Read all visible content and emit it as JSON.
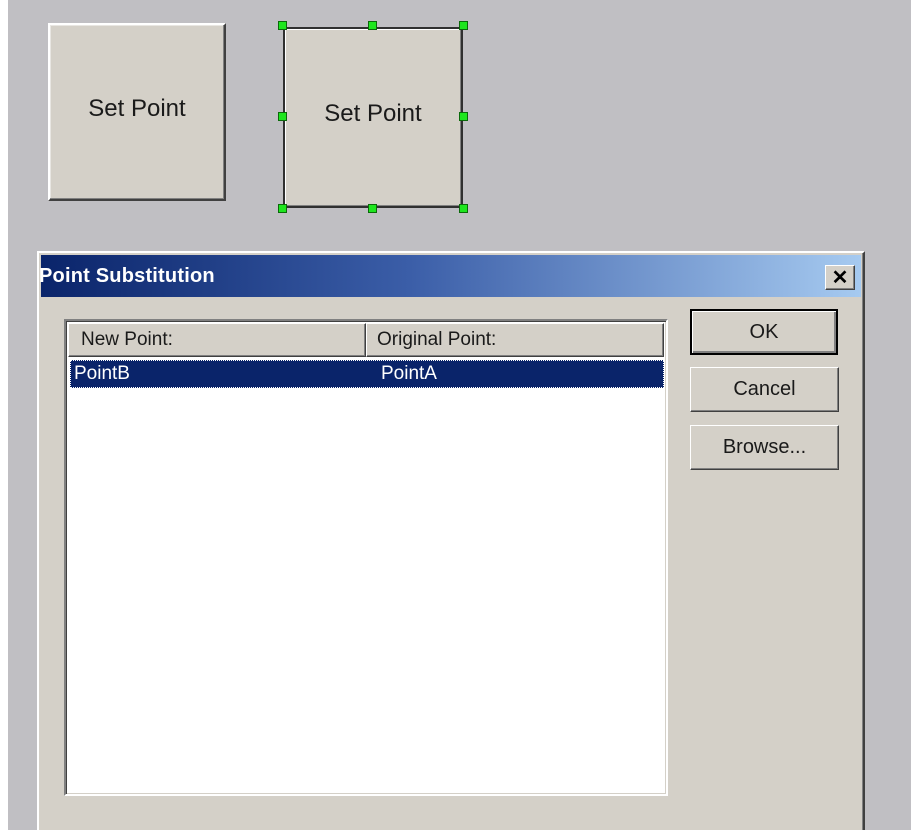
{
  "canvas": {
    "buttons": [
      {
        "label": "Set Point",
        "selected": false
      },
      {
        "label": "Set Point",
        "selected": true
      }
    ]
  },
  "dialog": {
    "title": "Point Substitution",
    "close_glyph": "✕",
    "columns": [
      "New Point:",
      "Original Point:"
    ],
    "rows": [
      {
        "new_point": "PointB",
        "original_point": "PointA",
        "selected": true
      }
    ],
    "buttons": {
      "ok": "OK",
      "cancel": "Cancel",
      "browse": "Browse..."
    }
  },
  "colors": {
    "selection_handle": "#1ee61e",
    "title_gradient_start": "#0a246a",
    "title_gradient_end": "#a6caf0",
    "row_selected": "#0a246a",
    "face": "#d4d0c8",
    "background": "#c0bfc3"
  }
}
